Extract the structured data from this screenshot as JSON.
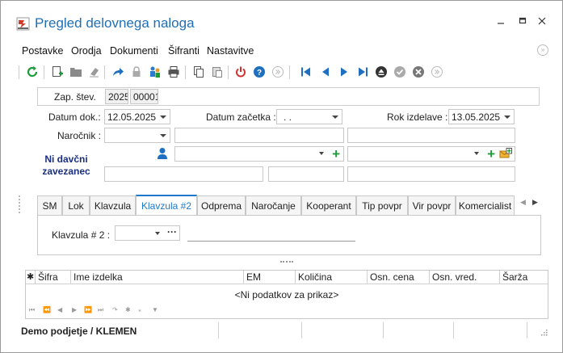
{
  "window": {
    "title": "Pregled delovnega naloga"
  },
  "menu": {
    "items": [
      "Postavke",
      "Orodja",
      "Dokumenti",
      "Šifranti",
      "Nastavitve"
    ]
  },
  "header": {
    "zap_label": "Zap. štev.",
    "year": "2025",
    "number": "00001"
  },
  "form": {
    "datum_dok_label": "Datum dok.:",
    "datum_dok_value": "12.05.2025",
    "datum_zacetka_label": "Datum začetka :",
    "datum_zacetka_value": ". .",
    "rok_izdelave_label": "Rok izdelave :",
    "rok_izdelave_value": "13.05.2025",
    "narocnik_label": "Naročnik :",
    "tax_status": "Ni davčni zavezanec"
  },
  "tabs": [
    "SM",
    "Lok",
    "Klavzula",
    "Klavzula #2",
    "Odprema",
    "Naročanje",
    "Kooperant",
    "Tip povpr",
    "Vir povpr",
    "Komercialist"
  ],
  "active_tab": "Klavzula #2",
  "klavzula": {
    "label": "Klavzula # 2 :",
    "dots": "···"
  },
  "grid": {
    "columns": [
      "Šifra",
      "Ime izdelka",
      "EM",
      "Količina",
      "Osn. cena",
      "Osn. vred.",
      "Šarža"
    ],
    "empty_text": "<Ni podatkov za prikaz>"
  },
  "status": {
    "company": "Demo podjetje / KLEMEN"
  },
  "colors": {
    "accent": "#1e78c8",
    "title": "#1f6fb5",
    "navy": "#1a2f80"
  }
}
